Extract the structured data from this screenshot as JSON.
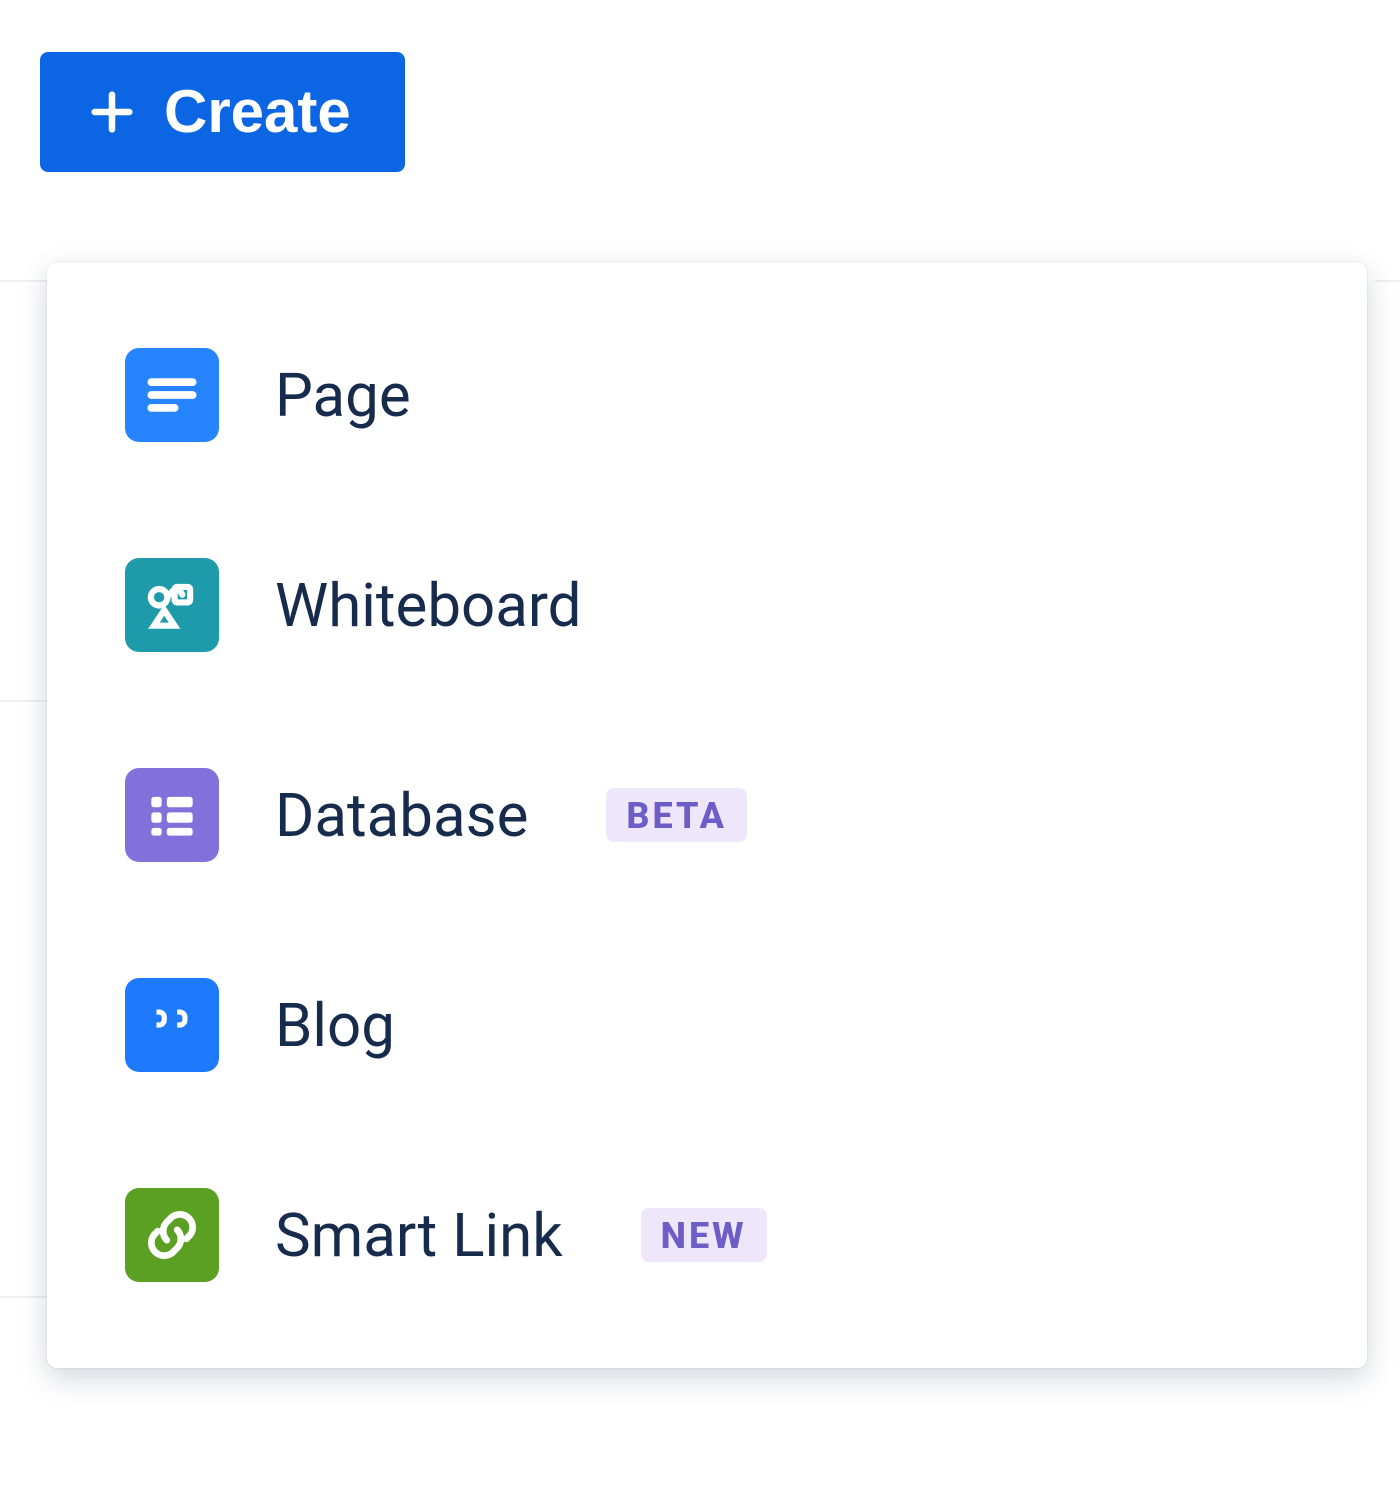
{
  "create": {
    "label": "Create"
  },
  "menu": {
    "items": [
      {
        "label": "Page"
      },
      {
        "label": "Whiteboard"
      },
      {
        "label": "Database",
        "badge": "BETA"
      },
      {
        "label": "Blog"
      },
      {
        "label": "Smart Link",
        "badge": "NEW"
      }
    ]
  }
}
